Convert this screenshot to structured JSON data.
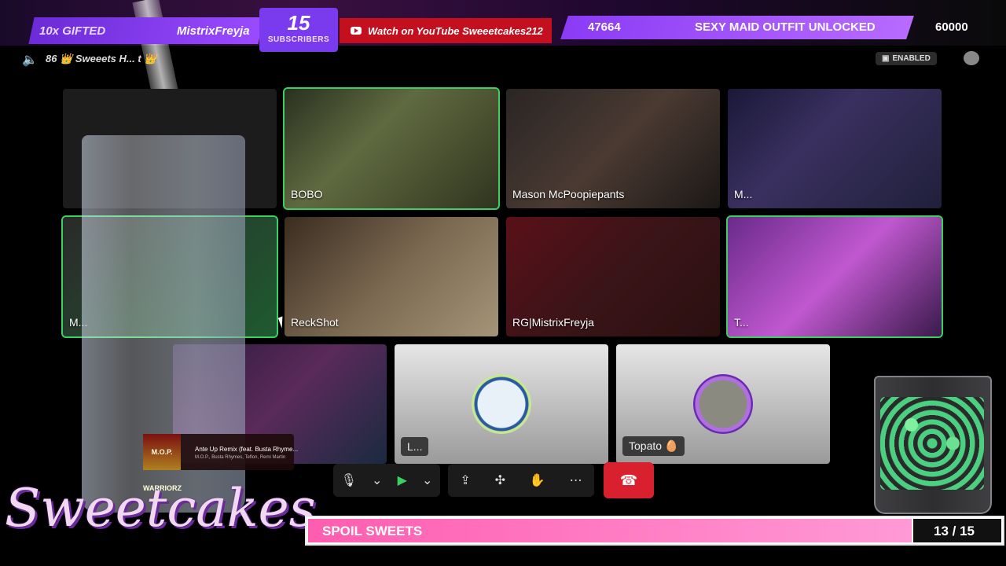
{
  "overlay": {
    "gifted_label": "10x GIFTED",
    "gifted_name": "MistrixFreyja",
    "subscribers_count": "15",
    "subscribers_label": "SUBSCRIBERS",
    "youtube_text": "Watch on YouTube Sweeetcakes212",
    "goal_current": "47664",
    "goal_text": "SEXY MAID OUTFIT UNLOCKED",
    "goal_max": "60000",
    "logo_text": "Sweetcakes",
    "progress_label": "SPOIL SWEETS",
    "progress_count": "13 / 15",
    "progress_fraction": 0.8667
  },
  "meeting": {
    "title": "86 👑 Sweeets H... t 👑",
    "enabled_badge": "ENABLED"
  },
  "participants": [
    {
      "name": "BOBO"
    },
    {
      "name": "Mason McPoopiepants"
    },
    {
      "name": "M..."
    },
    {
      "name": "M..."
    },
    {
      "name": "ReckShot"
    },
    {
      "name": "RG|MistrixFreyja"
    },
    {
      "name": "T..."
    },
    {
      "name": "L..."
    },
    {
      "name": "Topato 🥚"
    }
  ],
  "now_playing": {
    "art_label": "M.O.P. WARRIORZ",
    "title": "Ante Up Remix (feat. Busta Rhyme...",
    "subtitle": "M.O.P., Busta Rhymes, Teflon, Remi Martin"
  },
  "toolbar": {
    "mic": "microphone-icon",
    "camera": "camera-icon",
    "share": "screen-share-icon",
    "apps": "apps-icon",
    "reactions": "raise-hand-icon",
    "more": "more-icon",
    "hangup": "hangup-icon",
    "mic_glyph": "🎙",
    "chev": "⌄",
    "cam_glyph": "▶",
    "share_glyph": "⇪",
    "apps_glyph": "✣",
    "hand_glyph": "✋",
    "more_glyph": "⋯",
    "hang_glyph": "☎"
  },
  "colors": {
    "highlight": "#3ad064",
    "brand_purple": "#8a3bf5",
    "youtube_red": "#c4101e",
    "progress_pink": "#ff5db0",
    "hangup_red": "#d8202e"
  }
}
